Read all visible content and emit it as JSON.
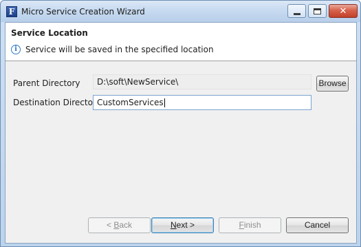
{
  "window": {
    "title": "Micro Service Creation Wizard",
    "icon": "F-logo-icon"
  },
  "header": {
    "title": "Service Location",
    "subtitle": "Service will be saved in the specified location"
  },
  "form": {
    "parent_label": "Parent Directory",
    "parent_value": "D:\\soft\\NewService\\",
    "destination_label": "Destination Directory",
    "destination_value": "CustomServices",
    "browse_label": "Browse"
  },
  "buttons": {
    "back": {
      "prefix": "< ",
      "mnemonic": "B",
      "rest": "ack",
      "enabled": false
    },
    "next": {
      "mnemonic": "N",
      "rest": "ext >",
      "enabled": true
    },
    "finish": {
      "mnemonic": "F",
      "rest": "inish",
      "enabled": false
    },
    "cancel": {
      "label": "Cancel",
      "enabled": true
    }
  },
  "colors": {
    "accent": "#2f78c8",
    "close_button": "#c2412a"
  }
}
